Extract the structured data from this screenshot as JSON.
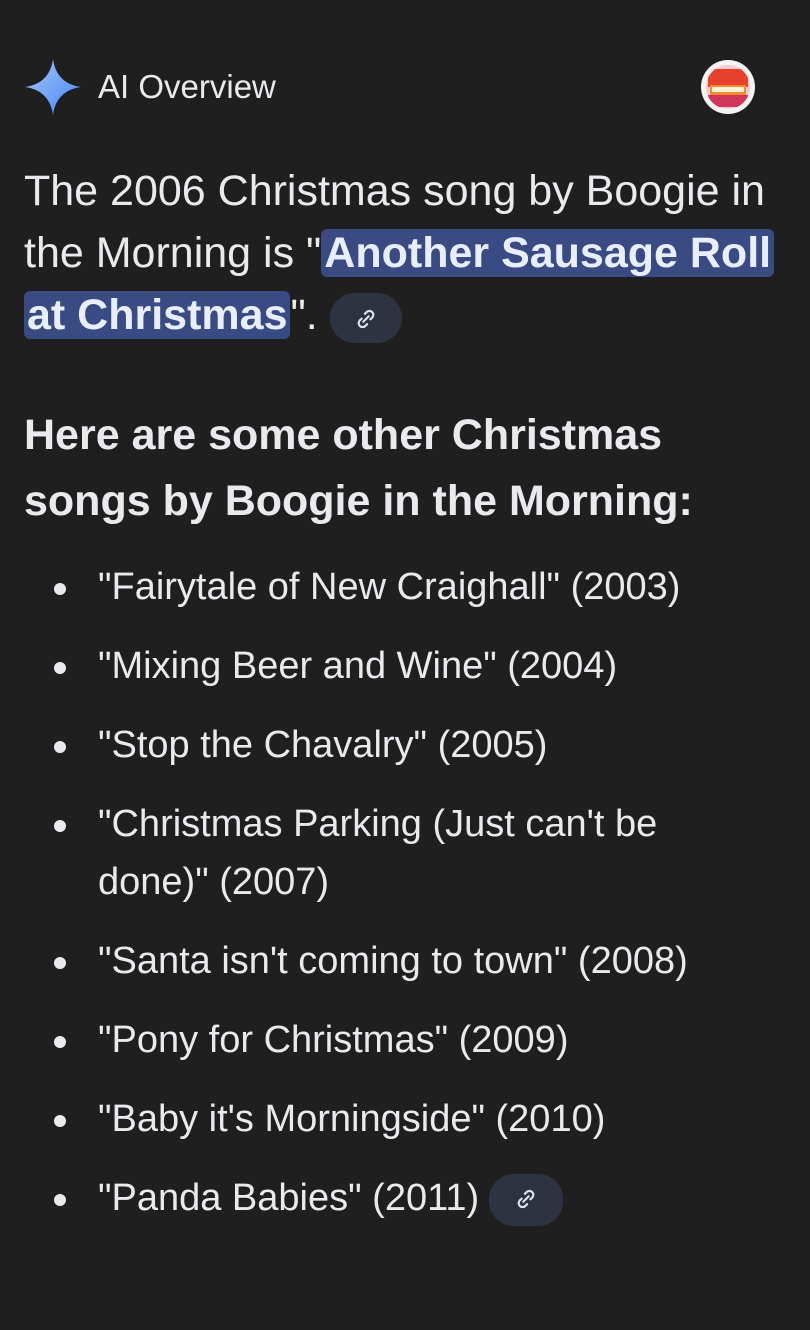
{
  "header": {
    "title": "AI Overview",
    "icon": "gemini-spark-icon",
    "avatar": "source-avatar"
  },
  "intro": {
    "line1": "The 2006 Christmas song by Boogie in",
    "line2_pre": "the Morning is \"",
    "highlight_part1": "Another Sausage Roll",
    "highlight_part2": "at Christmas",
    "line3_post": "\".",
    "link_icon": "link-icon"
  },
  "subheading": "Here are some other Christmas songs by Boogie in the Morning:",
  "songs": [
    "\"Fairytale of New Craighall\" (2003)",
    "\"Mixing Beer and Wine\" (2004)",
    "\"Stop the Chavalry\" (2005)",
    "\"Christmas Parking (Just can't be done)\" (2007)",
    "\"Santa isn't coming to town\" (2008)",
    "\"Pony for Christmas\" (2009)",
    "\"Baby it's Morningside\" (2010)",
    "\"Panda Babies\" (2011)"
  ],
  "colors": {
    "background": "#1f1f1f",
    "text": "#e8eaed",
    "highlight": "#394b82",
    "chip": "#2d3340",
    "spark_top": "#8ab4f8",
    "spark_bottom": "#4285f4"
  }
}
